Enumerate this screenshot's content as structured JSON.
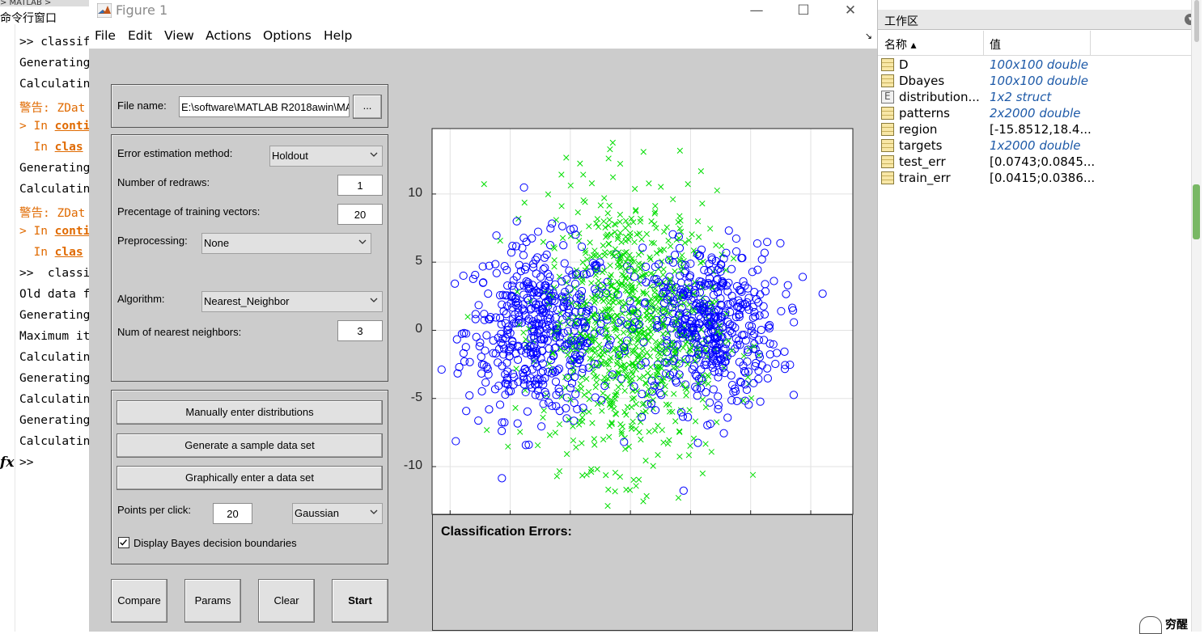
{
  "command_window": {
    "topbar": "> MATLAB >",
    "title": "命令行窗口",
    "lines": [
      {
        "prompt": ">> ",
        "text": "classifi"
      },
      {
        "prompt": "",
        "text": "Generating"
      },
      {
        "prompt": "",
        "text": "Calculatin"
      },
      {
        "prompt": "",
        "text": "警告: ZDat"
      },
      {
        "prompt": "> In ",
        "text": "conti"
      },
      {
        "prompt": "  In ",
        "text": "clas"
      },
      {
        "prompt": "",
        "text": "Generating"
      },
      {
        "prompt": "",
        "text": "Calculatin"
      },
      {
        "prompt": "",
        "text": "警告: ZDat"
      },
      {
        "prompt": "> In ",
        "text": "conti"
      },
      {
        "prompt": "  In ",
        "text": "clas"
      },
      {
        "prompt": ">>  ",
        "text": "classi"
      },
      {
        "prompt": "",
        "text": "Old data f"
      },
      {
        "prompt": "",
        "text": "Generating"
      },
      {
        "prompt": "",
        "text": "Maximum it"
      },
      {
        "prompt": "",
        "text": "Calculatin"
      },
      {
        "prompt": "",
        "text": "Generating"
      },
      {
        "prompt": "",
        "text": "Calculatin"
      },
      {
        "prompt": "",
        "text": "Generating"
      },
      {
        "prompt": "",
        "text": "Calculatin"
      },
      {
        "prompt": ">>",
        "text": ""
      }
    ],
    "fx": "fx"
  },
  "workspace": {
    "title": "工作区",
    "col_name": "名称 ▴",
    "col_value": "值",
    "rows": [
      {
        "name": "D",
        "value": "100x100 double",
        "italic": true,
        "icon": "matrix"
      },
      {
        "name": "Dbayes",
        "value": "100x100 double",
        "italic": true,
        "icon": "matrix"
      },
      {
        "name": "distribution...",
        "value": "1x2 struct",
        "italic": true,
        "icon": "struct"
      },
      {
        "name": "patterns",
        "value": "2x2000 double",
        "italic": true,
        "icon": "matrix"
      },
      {
        "name": "region",
        "value": "[-15.8512,18.4...",
        "italic": false,
        "icon": "matrix"
      },
      {
        "name": "targets",
        "value": "1x2000 double",
        "italic": true,
        "icon": "matrix"
      },
      {
        "name": "test_err",
        "value": "[0.0743;0.0845...",
        "italic": false,
        "icon": "matrix"
      },
      {
        "name": "train_err",
        "value": "[0.0415;0.0386...",
        "italic": false,
        "icon": "matrix"
      }
    ],
    "badge": "穷醒"
  },
  "figure": {
    "title": "Figure 1",
    "controls": {
      "minimize": "—",
      "maximize": "☐",
      "close": "✕"
    },
    "menu": [
      "File",
      "Edit",
      "View",
      "Actions",
      "Options",
      "Help"
    ],
    "dock": "↘",
    "file_panel": {
      "label": "File name:",
      "value": "E:\\software\\MATLAB R2018awin\\MATLAB",
      "browse": "..."
    },
    "params_panel": {
      "error_method_label": "Error estimation method:",
      "error_method_value": "Holdout",
      "redraws_label": "Number of redraws:",
      "redraws_value": "1",
      "training_label": "Precentage of training vectors:",
      "training_value": "20",
      "preprocessing_label": "Preprocessing:",
      "preprocessing_value": "None",
      "algorithm_label": "Algorithm:",
      "algorithm_value": "Nearest_Neighbor",
      "nn_label": "Num of nearest neighbors:",
      "nn_value": "3"
    },
    "data_panel": {
      "manual": "Manually enter distributions",
      "generate": "Generate a sample data set",
      "graphical": "Graphically enter a data set",
      "ppc_label": "Points per click:",
      "ppc_value": "20",
      "dist_value": "Gaussian",
      "bayes_label": "Display Bayes decision boundaries",
      "bayes_checked": true
    },
    "buttons": {
      "compare": "Compare",
      "params": "Params",
      "clear": "Clear",
      "start": "Start"
    },
    "errors_title": "Classification Errors:"
  },
  "chart_data": {
    "type": "scatter",
    "xlim": [
      -16.5,
      18.5
    ],
    "ylim": [
      -13.5,
      14.8
    ],
    "xticks": [
      -15,
      -10,
      -5,
      0,
      5,
      10,
      15
    ],
    "yticks": [
      -10,
      -5,
      0,
      5,
      10
    ],
    "grid": true,
    "series": [
      {
        "marker": "o",
        "color": "#0000ff",
        "clusters": [
          {
            "mx": -7.5,
            "my": 0.0,
            "sx": 3.1,
            "sy": 3.2,
            "n": 500
          },
          {
            "mx": 6.2,
            "my": 0.3,
            "sx": 3.1,
            "sy": 3.0,
            "n": 500
          }
        ]
      },
      {
        "marker": "x",
        "color": "#00dd00",
        "clusters": [
          {
            "mx": 0.0,
            "my": 0.2,
            "sx": 3.6,
            "sy": 5.0,
            "n": 900
          }
        ]
      }
    ]
  }
}
